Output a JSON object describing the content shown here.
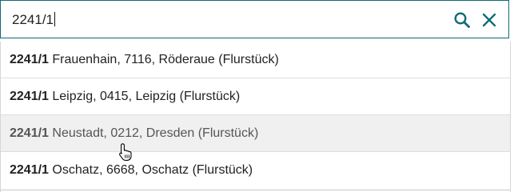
{
  "search": {
    "value": "2241/1",
    "icons": {
      "search": "search-icon",
      "clear": "close-icon"
    }
  },
  "colors": {
    "accent": "#0f6b77",
    "hover_row": "#f0f0f0",
    "text": "#222222"
  },
  "results": [
    {
      "lot": "2241/1",
      "detail": " Frauenhain, 7116, Röderaue (Flurstück)"
    },
    {
      "lot": "2241/1",
      "detail": " Leipzig, 0415, Leipzig (Flurstück)"
    },
    {
      "lot": "2241/1",
      "detail": " Neustadt, 0212, Dresden (Flurstück)",
      "hovered": true
    },
    {
      "lot": "2241/1",
      "detail": " Oschatz, 6668, Oschatz (Flurstück)"
    }
  ],
  "cursor": {
    "type": "hand-pointer-icon"
  }
}
